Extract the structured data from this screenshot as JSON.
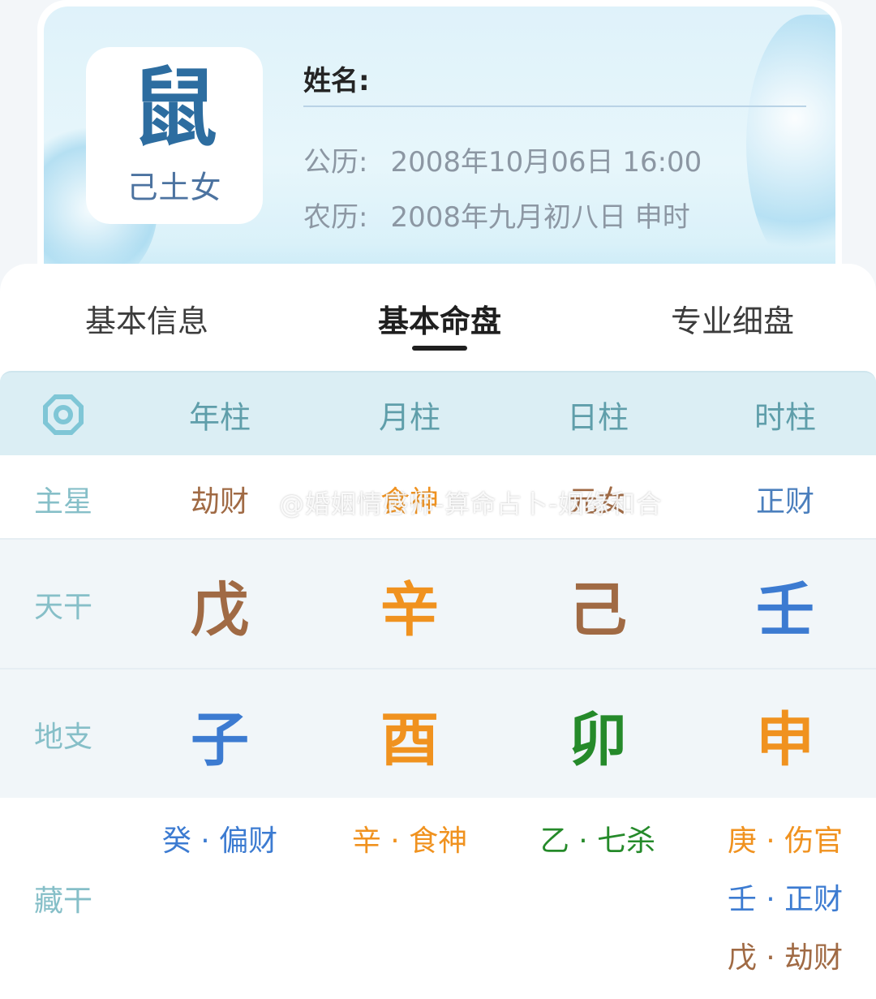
{
  "profile": {
    "zodiac": "鼠",
    "zodiac_sub": "己土女",
    "name_label": "姓名:",
    "solar_label": "公历:",
    "solar_value": "2008年10月06日 16:00",
    "lunar_label": "农历:",
    "lunar_value": "2008年九月初八日 申时"
  },
  "tabs": [
    "基本信息",
    "基本命盘",
    "专业细盘"
  ],
  "active_tab": "基本命盘",
  "table": {
    "header": [
      "年柱",
      "月柱",
      "日柱",
      "时柱"
    ],
    "row_labels": {
      "main_star": "主星",
      "heavenly_stem": "天干",
      "earthly_branch": "地支",
      "hidden_stem": "藏干"
    },
    "main_star": [
      "劫财",
      "食神",
      "元女",
      "正财"
    ],
    "heavenly_stem": [
      "戊",
      "辛",
      "己",
      "壬"
    ],
    "earthly_branch": [
      "子",
      "酉",
      "卯",
      "申"
    ],
    "hidden_stems": [
      [
        "癸 · 偏财"
      ],
      [
        "辛 · 食神"
      ],
      [
        "乙 · 七杀"
      ],
      [
        "庚 · 伤官",
        "壬 · 正财",
        "戊 · 劫财"
      ]
    ]
  },
  "watermark": "@婚姻情感师-算命占卜-姻缘和合",
  "colors": {
    "earth_brown": "#a06a44",
    "metal_orange": "#f0921f",
    "water_blue": "#3c7bd1",
    "wood_green": "#258a2a",
    "header_bg": "#dbeef4",
    "zodiac_blue": "#2d6da0"
  }
}
